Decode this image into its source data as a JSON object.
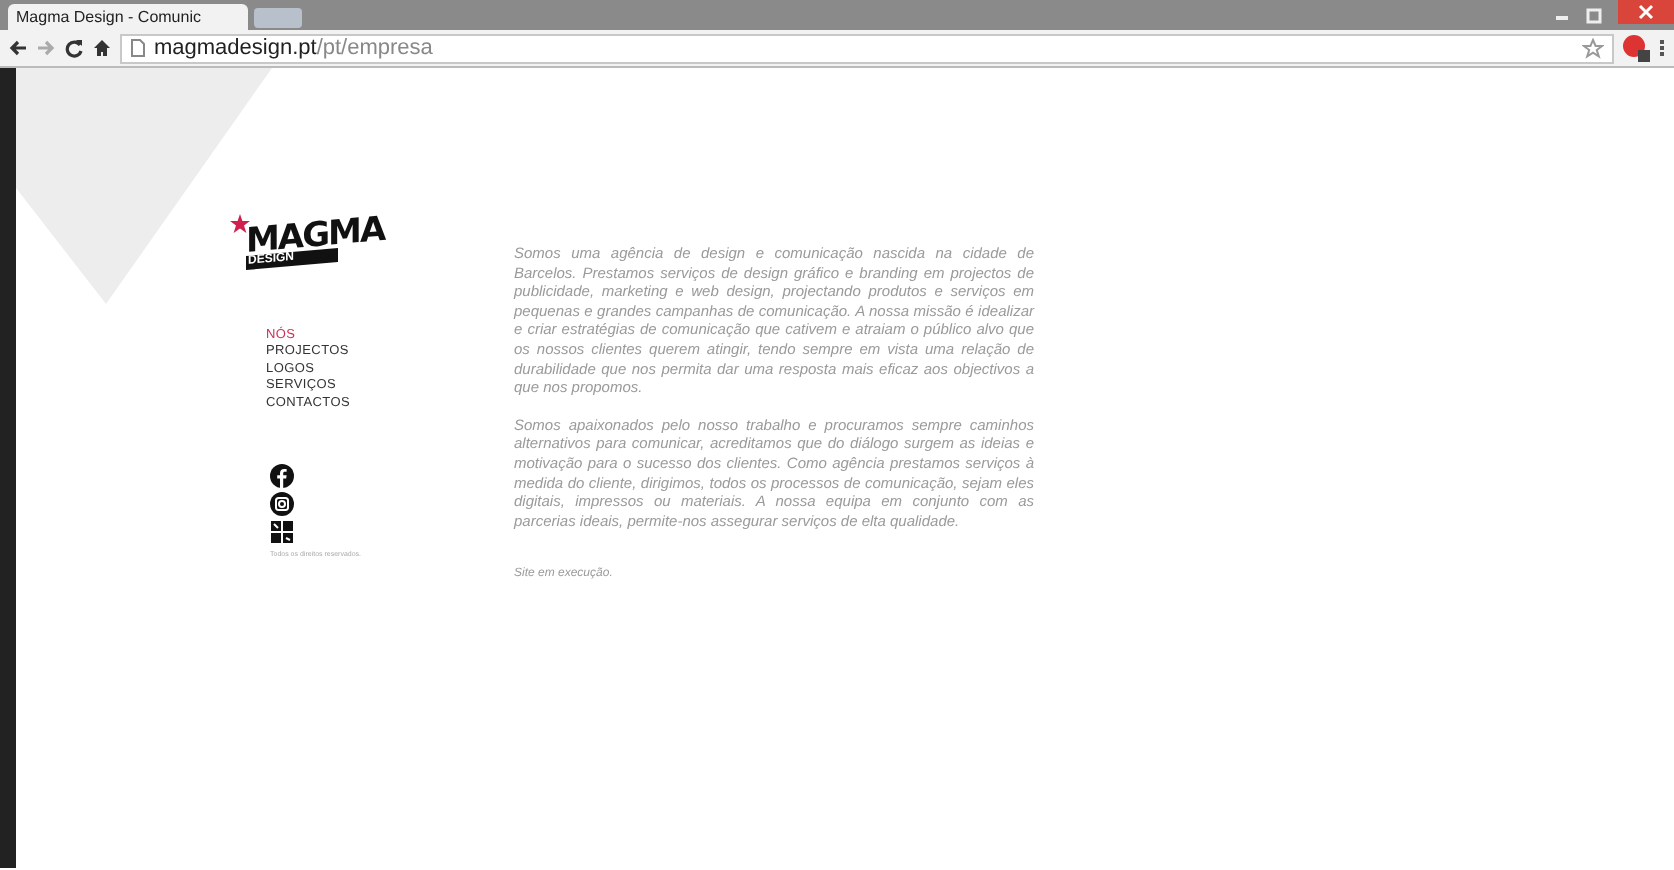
{
  "browser": {
    "tab_title": "Magma Design - Comunic",
    "url_host": "magmadesign.pt",
    "url_path": "/pt/empresa"
  },
  "logo": {
    "word": "MAGMA",
    "subword": "DESIGN"
  },
  "nav": [
    {
      "label": "NÓS",
      "selected": true
    },
    {
      "label": "PROJECTOS",
      "selected": false
    },
    {
      "label": "LOGOS",
      "selected": false
    },
    {
      "label": "SERVIÇOS",
      "selected": false
    },
    {
      "label": "CONTACTOS",
      "selected": false
    }
  ],
  "social": [
    {
      "kind": "facebook"
    },
    {
      "kind": "instagram"
    },
    {
      "kind": "blog"
    }
  ],
  "copyright": "Todos os direitos reservados.",
  "paragraphs": [
    " Somos uma agência de design e comunicação nascida na cidade de Barcelos. Prestamos serviços de design gráfico e branding em projectos de publicidade, marketing e web design, projectando produtos e serviços em pequenas e grandes campanhas de comunicação. A nossa missão é idealizar e criar estratégias de comunicação que cativem e atraiam o público alvo que os nossos clientes querem atingir, tendo sempre em vista uma relação de durabilidade que nos permita dar uma resposta mais eficaz aos objectivos a que nos propomos.",
    "Somos apaixonados pelo nosso trabalho e procuramos sempre caminhos alternativos para comunicar, acreditamos que do diálogo surgem as ideias e motivação para o sucesso dos clientes. Como agência prestamos serviços à medida do cliente, dirigimos, todos os processos de comunicação, sejam eles digitais, impressos ou materiais. A nossa equipa em conjunto com as  parcerias ideais, permite-nos assegurar serviços de elta qualidade."
  ],
  "status_note": "Site em execução."
}
